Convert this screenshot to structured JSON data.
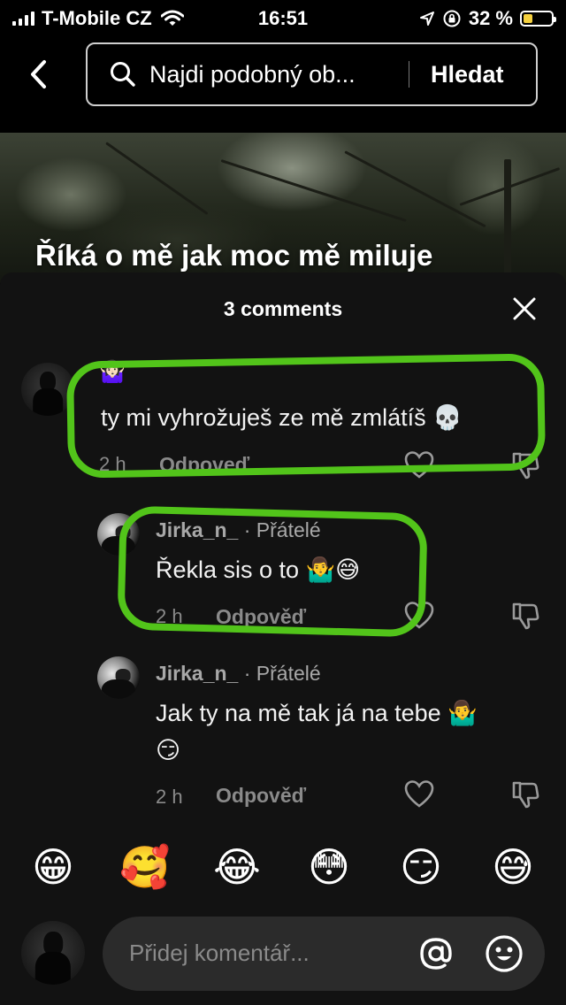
{
  "status_bar": {
    "carrier": "T-Mobile CZ",
    "time": "16:51",
    "battery_percent": "32 %",
    "battery_level": 0.32,
    "icons": [
      "signal-icon",
      "wifi-icon",
      "location-icon",
      "rotation-lock-icon",
      "battery-icon"
    ]
  },
  "search": {
    "query": "Najdi podobný ob...",
    "submit_label": "Hledat",
    "icons": [
      "back-icon",
      "search-icon"
    ]
  },
  "video": {
    "caption": "Říká o mě jak moc mě miluje"
  },
  "comments_sheet": {
    "title": "3 comments",
    "comments": [
      {
        "username": "",
        "badge": "",
        "emoji_top": "🤷🏻‍♀️",
        "text": "ty mi vyhrožuješ ze mě zmlátíš 💀",
        "time": "2 h",
        "reply_label": "Odpoveď"
      },
      {
        "username": "Jirka_n_",
        "badge": "· Přátelé",
        "text": "Řekla sis o to 🤷‍♂️😅",
        "time": "2 h",
        "reply_label": "Odpověď"
      },
      {
        "username": "Jirka_n_",
        "badge": "· Přátelé",
        "text_line1": "Jak ty na mě tak já na tebe 🤷‍♂️",
        "text_line2": "😏",
        "time": "2 h",
        "reply_label": "Odpověď"
      }
    ]
  },
  "emoji_bar": [
    "😁",
    "🥰",
    "😂",
    "😳",
    "😏",
    "😅"
  ],
  "comment_input": {
    "placeholder": "Přidej komentář..."
  },
  "colors": {
    "highlight": "#52c41a",
    "sheet_bg": "#121212",
    "input_bg": "#2b2b2b"
  }
}
